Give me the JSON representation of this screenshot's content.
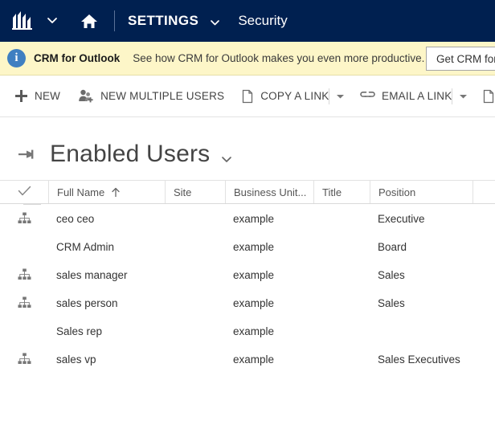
{
  "topbar": {
    "logo_icon": "dynamics-crm-logo-icon",
    "nav_caret_icon": "chevron-down-icon",
    "home_icon": "home-icon",
    "module_label": "SETTINGS",
    "module_caret_icon": "chevron-down-icon",
    "subarea_label": "Security"
  },
  "notification": {
    "icon": "info-icon",
    "icon_glyph": "i",
    "title": "CRM for Outlook",
    "message": "See how CRM for Outlook makes you even more productive.",
    "button_label": "Get CRM for Outlook",
    "band_color": "#fdf6c8",
    "icon_color": "#3f7fc1"
  },
  "commandbar": {
    "items": [
      {
        "label": "NEW",
        "icon": "plus-icon",
        "has_caret": false
      },
      {
        "label": "NEW MULTIPLE USERS",
        "icon": "add-users-icon",
        "has_caret": false
      },
      {
        "label": "COPY A LINK",
        "icon": "document-icon",
        "has_caret": true
      },
      {
        "label": "EMAIL A LINK",
        "icon": "link-icon",
        "has_caret": true
      }
    ],
    "overflow_icon": "document-icon",
    "caret_icon": "caret-down-icon"
  },
  "view": {
    "pin_icon": "pin-icon",
    "title": "Enabled Users",
    "caret_icon": "chevron-down-icon"
  },
  "grid": {
    "select_all_icon": "checkmark-icon",
    "sort_column": "Full Name",
    "sort_direction": "ascending",
    "sort_icon": "arrow-up-icon",
    "row_icon": "org-hierarchy-icon",
    "columns": [
      {
        "label": "Full Name"
      },
      {
        "label": "Site"
      },
      {
        "label": "Business Unit..."
      },
      {
        "label": "Title"
      },
      {
        "label": "Position"
      }
    ],
    "rows": [
      {
        "has_icon": true,
        "full_name": "ceo ceo",
        "site": "",
        "business_unit": "example",
        "title": "",
        "position": "Executive"
      },
      {
        "has_icon": false,
        "full_name": "CRM Admin",
        "site": "",
        "business_unit": "example",
        "title": "",
        "position": "Board"
      },
      {
        "has_icon": true,
        "full_name": "sales manager",
        "site": "",
        "business_unit": "example",
        "title": "",
        "position": "Sales"
      },
      {
        "has_icon": true,
        "full_name": "sales person",
        "site": "",
        "business_unit": "example",
        "title": "",
        "position": "Sales"
      },
      {
        "has_icon": false,
        "full_name": "Sales rep",
        "site": "",
        "business_unit": "example",
        "title": "",
        "position": ""
      },
      {
        "has_icon": true,
        "full_name": "sales vp",
        "site": "",
        "business_unit": "example",
        "title": "",
        "position": "Sales Executives"
      }
    ]
  },
  "colors": {
    "header_navy": "#002050",
    "text_dark": "#333333",
    "text_muted": "#555555",
    "border": "#e2e2e2"
  }
}
